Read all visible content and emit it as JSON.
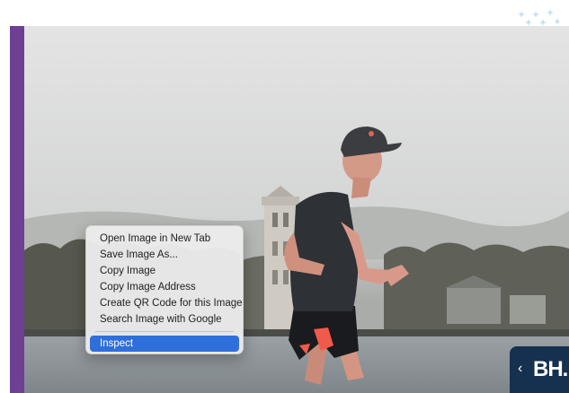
{
  "context_menu": {
    "items": [
      "Open Image in New Tab",
      "Save Image As...",
      "Copy Image",
      "Copy Image Address",
      "Create QR Code for this Image",
      "Search Image with Google"
    ],
    "inspect_label": "Inspect"
  },
  "brand_badge": {
    "chevron": "‹",
    "logo_text": "BH."
  },
  "icons": {
    "sparkles": "sparkles-icon",
    "chevron": "chevron-left-icon"
  },
  "colors": {
    "accent_bar": "#6e3f93",
    "menu_highlight": "#2f6fdc",
    "badge_bg": "#16304f",
    "sparkle": "#bfe0f0"
  }
}
